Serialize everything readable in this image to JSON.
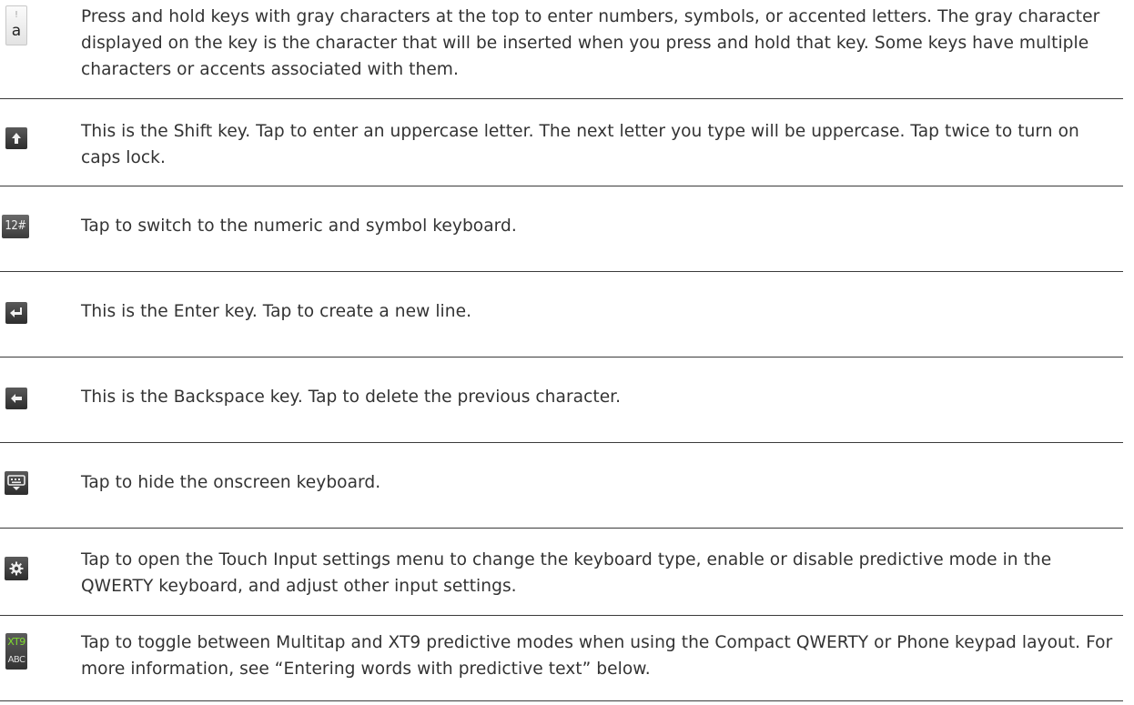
{
  "keys": [
    {
      "icon": "gray-character-key-icon",
      "key_top_char": "!",
      "key_main_char": "a",
      "description": "Press and hold keys with gray characters at the top to enter numbers, symbols, or accented letters. The gray character displayed on the key is the character that will be inserted when you press and hold that key. Some keys have multiple characters or accents associated with them."
    },
    {
      "icon": "shift-key-icon",
      "description": "This is the Shift key. Tap to enter an uppercase letter. The next letter you type will be uppercase. Tap twice to turn on caps lock."
    },
    {
      "icon": "numeric-symbol-key-icon",
      "key_label": "12#",
      "description": "Tap to switch to the numeric and symbol keyboard."
    },
    {
      "icon": "enter-key-icon",
      "description": "This is the Enter key. Tap to create a new line."
    },
    {
      "icon": "backspace-key-icon",
      "description": "This is the Backspace key. Tap to delete the previous character."
    },
    {
      "icon": "hide-keyboard-key-icon",
      "description": "Tap to hide the onscreen keyboard."
    },
    {
      "icon": "settings-gear-key-icon",
      "description": "Tap to open the Touch Input settings menu to change the keyboard type, enable or disable predictive mode in the QWERTY keyboard, and adjust other input settings."
    },
    {
      "icon": "xt9-abc-toggle-key-icon",
      "key_top_label": "XT9",
      "key_bottom_label": "ABC",
      "description": "Tap to toggle between Multitap and XT9 predictive modes when using the Compact QWERTY or Phone keypad layout. For more information, see “Entering words with predictive text” below."
    }
  ],
  "colors": {
    "text": "#333333",
    "rule": "#3a3a3a",
    "xt9_green": "#7fdc2e"
  }
}
